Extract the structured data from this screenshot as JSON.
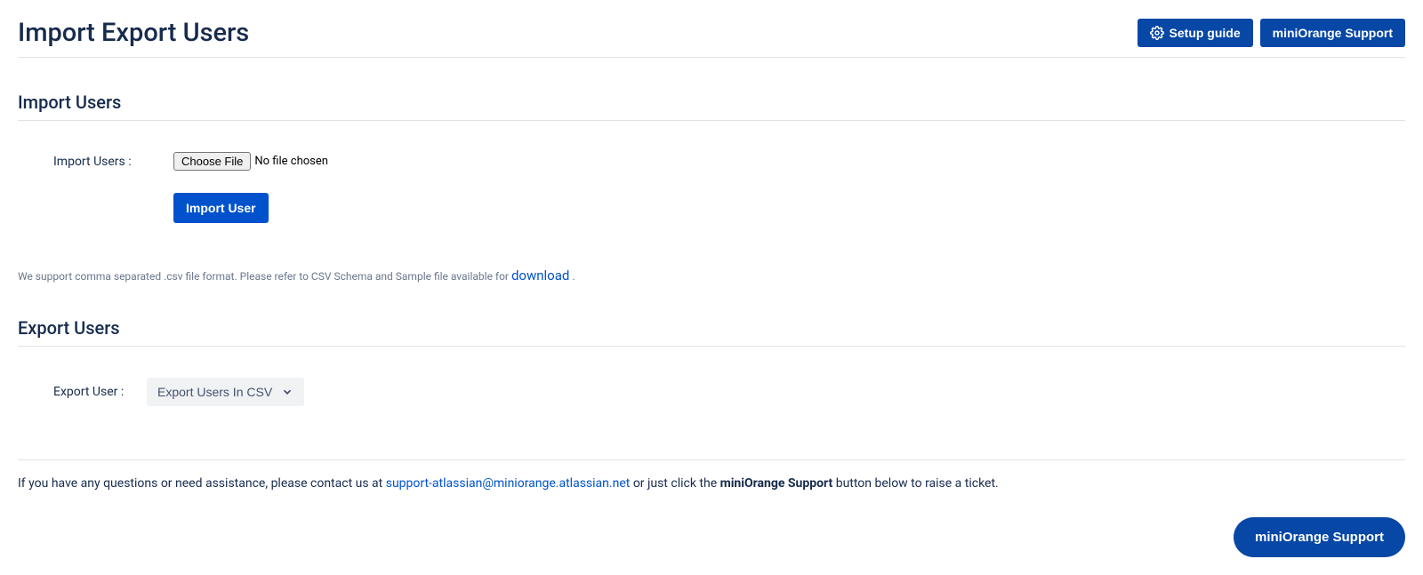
{
  "header": {
    "title": "Import Export Users",
    "setup_guide_label": "Setup guide",
    "support_label": "miniOrange Support"
  },
  "import": {
    "section_title": "Import Users",
    "label": "Import Users :",
    "choose_file_label": "Choose File",
    "file_status": "No file chosen",
    "import_button_label": "Import User",
    "help_prefix": "We support comma separated .csv file format. Please refer to CSV Schema and Sample file available for ",
    "help_link": "download",
    "help_suffix": " ."
  },
  "export": {
    "section_title": "Export Users",
    "label": "Export User :",
    "dropdown_selected": "Export Users In CSV"
  },
  "footer": {
    "text_prefix": "If you have any questions or need assistance, please contact us at ",
    "email": "support-atlassian@miniorange.atlassian.net",
    "text_middle": " or just click the ",
    "bold_text": "miniOrange Support",
    "text_suffix": " button below to raise a ticket.",
    "button_label": "miniOrange Support"
  }
}
